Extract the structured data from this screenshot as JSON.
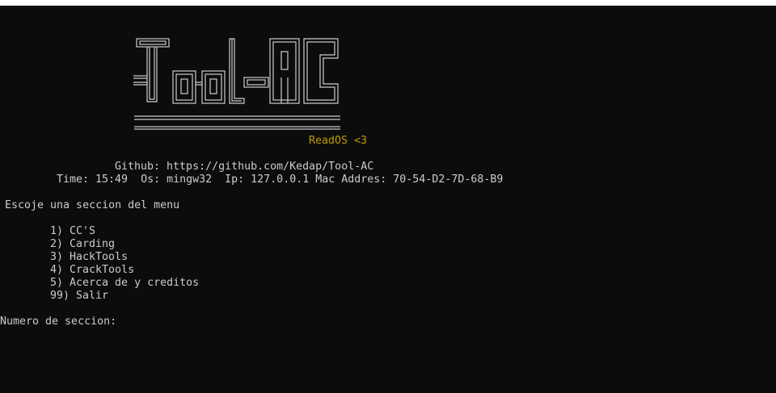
{
  "colors": {
    "background": "#0c0c0c",
    "text": "#cccccc",
    "accent": "#c19c00"
  },
  "banner": {
    "logo_text": "Tool-AC",
    "tagline": "ReadOS <3"
  },
  "info": {
    "github_line": "Github: https://github.com/Kedap/Tool-AC",
    "status_line": "Time: 15:49  Os: mingw32  Ip: 127.0.0.1 Mac Addres: 70-54-D2-7D-68-B9"
  },
  "menu": {
    "prompt": "Escoje una seccion del menu",
    "items": [
      "1) CC'S",
      "2) Carding",
      "3) HackTools",
      "4) CrackTools",
      "5) Acerca de y creditos",
      "99) Salir"
    ]
  },
  "input": {
    "prompt": "Numero de seccion:",
    "value": ""
  }
}
